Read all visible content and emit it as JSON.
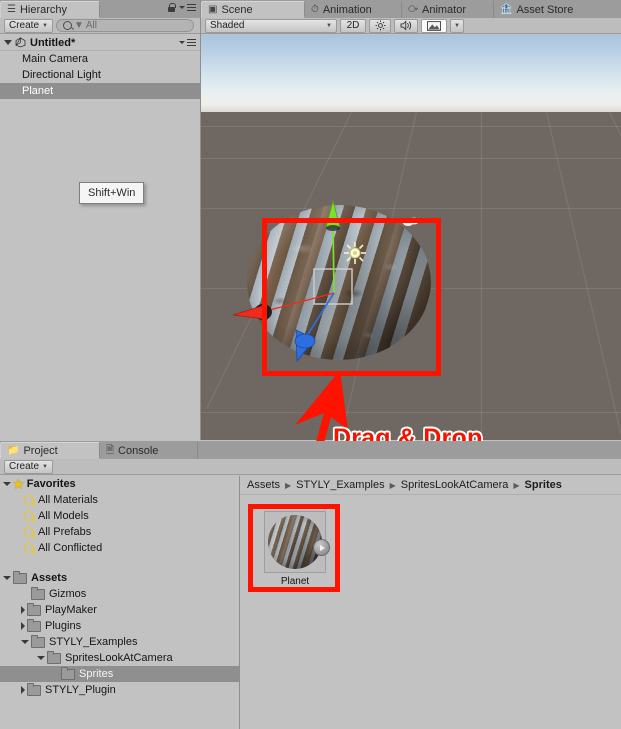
{
  "hierarchy": {
    "tab_label": "Hierarchy",
    "tab_icon": "hierarchy-icon",
    "lock_icon": "lock-icon",
    "menu_icon": "panel-menu-icon",
    "create_label": "Create",
    "search_placeholder": "All",
    "search_value": "All",
    "search_icon": "search-icon",
    "scene_name": "Untitled*",
    "items": [
      {
        "label": "Main Camera",
        "selected": false
      },
      {
        "label": "Directional Light",
        "selected": false
      },
      {
        "label": "Planet",
        "selected": true
      }
    ]
  },
  "scene": {
    "tabs": [
      {
        "label": "Scene",
        "icon": "grid-icon",
        "active": true
      },
      {
        "label": "Animation",
        "icon": "clock-icon",
        "active": false
      },
      {
        "label": "Animator",
        "icon": "animator-icon",
        "active": false
      },
      {
        "label": "Asset Store",
        "icon": "store-icon",
        "active": false
      }
    ],
    "toolbar": {
      "draw_mode": "Shaded",
      "two_d_label": "2D",
      "lighting_icon": "sun-icon",
      "audio_icon": "speaker-icon",
      "effects_icon": "image-icon",
      "effects_caret": "chevron-down-icon"
    },
    "selected_object": "Planet",
    "gizmo": {
      "x_axis_color": "#ef2b1c",
      "y_axis_color": "#7ae22a",
      "z_axis_color": "#2e6fe0",
      "light_gizmo_icon": "directional-light-gizmo"
    },
    "selection_outline_color": "#fe1200"
  },
  "annotation": {
    "drag_drop_label": "Drag & Drop",
    "drag_drop_color": "#f11500",
    "arrow_color": "#fe1200",
    "tooltip_label": "Shift+Win"
  },
  "project": {
    "tabs": [
      {
        "label": "Project",
        "icon": "folder-icon",
        "active": true
      },
      {
        "label": "Console",
        "icon": "console-icon",
        "active": false
      }
    ],
    "create_label": "Create",
    "tree": [
      {
        "label": "Favorites",
        "indent": 0,
        "arrow": "open",
        "icon": "star-icon",
        "bold": true,
        "selected": false
      },
      {
        "label": "All Materials",
        "indent": 1,
        "arrow": "none",
        "icon": "search-icon",
        "bold": false,
        "selected": false
      },
      {
        "label": "All Models",
        "indent": 1,
        "arrow": "none",
        "icon": "search-icon",
        "bold": false,
        "selected": false
      },
      {
        "label": "All Prefabs",
        "indent": 1,
        "arrow": "none",
        "icon": "search-icon",
        "bold": false,
        "selected": false
      },
      {
        "label": "All Conflicted",
        "indent": 1,
        "arrow": "none",
        "icon": "search-icon",
        "bold": false,
        "selected": false
      },
      {
        "label": "",
        "indent": 0,
        "arrow": "none",
        "icon": "none",
        "bold": false,
        "selected": false
      },
      {
        "label": "Assets",
        "indent": 0,
        "arrow": "open",
        "icon": "folder-icon",
        "bold": true,
        "selected": false
      },
      {
        "label": "Gizmos",
        "indent": 1,
        "arrow": "none",
        "icon": "folder-icon",
        "bold": false,
        "selected": false
      },
      {
        "label": "PlayMaker",
        "indent": 1,
        "arrow": "closed",
        "icon": "folder-icon",
        "bold": false,
        "selected": false
      },
      {
        "label": "Plugins",
        "indent": 1,
        "arrow": "closed",
        "icon": "folder-icon",
        "bold": false,
        "selected": false
      },
      {
        "label": "STYLY_Examples",
        "indent": 1,
        "arrow": "open",
        "icon": "folder-icon",
        "bold": false,
        "selected": false
      },
      {
        "label": "SpritesLookAtCamera",
        "indent": 2,
        "arrow": "open",
        "icon": "folder-icon",
        "bold": false,
        "selected": false
      },
      {
        "label": "Sprites",
        "indent": 3,
        "arrow": "none",
        "icon": "folder-icon",
        "bold": false,
        "selected": true
      },
      {
        "label": "STYLY_Plugin",
        "indent": 1,
        "arrow": "closed",
        "icon": "folder-icon",
        "bold": false,
        "selected": false
      }
    ],
    "breadcrumb": [
      "Assets",
      "STYLY_Examples",
      "SpritesLookAtCamera",
      "Sprites"
    ],
    "assets": [
      {
        "label": "Planet",
        "selected": true,
        "has_play_badge": true
      }
    ]
  }
}
